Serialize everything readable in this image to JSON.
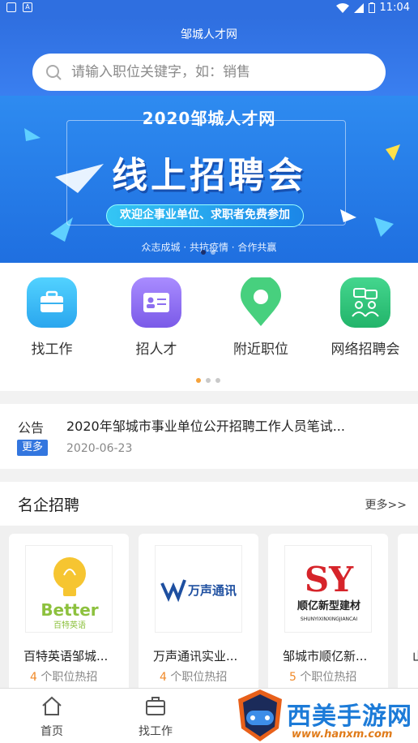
{
  "status_bar": {
    "time": "11:04"
  },
  "header": {
    "app_title": "邹城人才网",
    "search_placeholder": "请输入职位关键字，如：销售"
  },
  "banner": {
    "title_small": "2020邹城人才网",
    "title_big": "线上招聘会",
    "pill_text": "欢迎企事业单位、求职者免费参加",
    "slogan": "众志成城 · 共抗疫情 · 合作共赢"
  },
  "quick_menu": [
    {
      "label": "找工作",
      "icon": "briefcase-icon",
      "color": "#35b6f0"
    },
    {
      "label": "招人才",
      "icon": "id-card-icon",
      "color": "#8d6ff0"
    },
    {
      "label": "附近职位",
      "icon": "location-pin-icon",
      "color": "#43c979"
    },
    {
      "label": "网络招聘会",
      "icon": "chat-people-icon",
      "color": "#2fbf7a"
    }
  ],
  "notice": {
    "tag": "公告",
    "more_label": "更多",
    "title": "2020年邹城市事业单位公开招聘工作人员笔试...",
    "date": "2020-06-23"
  },
  "companies": {
    "section_title": "名企招聘",
    "more_label": "更多>>",
    "items": [
      {
        "name": "百特英语邹城...",
        "count": "4",
        "suffix": "个职位热招",
        "logo_text": "Better",
        "logo_sub": "百特英语"
      },
      {
        "name": "万声通讯实业...",
        "count": "4",
        "suffix": "个职位热招",
        "logo_text": "万声通讯"
      },
      {
        "name": "邹城市顺亿新...",
        "count": "5",
        "suffix": "个职位热招",
        "logo_text": "顺亿新型建材",
        "logo_sub": "SHUNYIXINXINGJIANCAI"
      },
      {
        "name": "山",
        "count": "",
        "suffix": ""
      }
    ]
  },
  "tabbar": [
    {
      "label": "首页",
      "icon": "home-icon"
    },
    {
      "label": "找工作",
      "icon": "briefcase-icon"
    }
  ],
  "watermark": {
    "title": "西美手游网",
    "url": "www.hanxm.com"
  }
}
